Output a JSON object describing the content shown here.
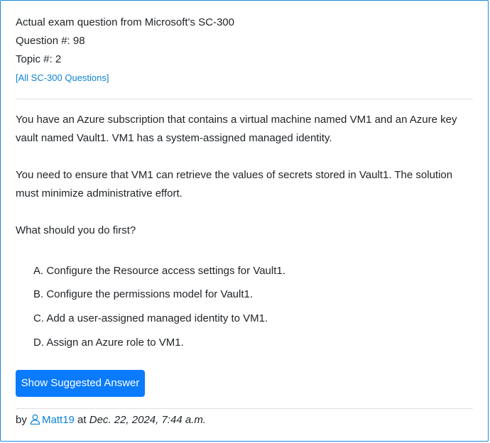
{
  "header": {
    "exam_line": "Actual exam question from Microsoft's SC-300",
    "question_number": "Question #: 98",
    "topic": "Topic #: 2",
    "all_questions_link": "[All SC-300 Questions]"
  },
  "question": {
    "paragraph_1": "You have an Azure subscription that contains a virtual machine named VM1 and an Azure key vault named Vault1. VM1 has a system-assigned managed identity.",
    "paragraph_2": "You need to ensure that VM1 can retrieve the values of secrets stored in Vault1. The solution must minimize administrative effort.",
    "prompt": "What should you do first?"
  },
  "choices": [
    "A. Configure the Resource access settings for Vault1.",
    "B. Configure the permissions model for Vault1.",
    "C. Add a user-assigned managed identity to VM1.",
    "D. Assign an Azure role to VM1."
  ],
  "actions": {
    "show_answer_label": "Show Suggested Answer"
  },
  "footer": {
    "by": "by",
    "username": "Matt19",
    "at": "at",
    "date": "Dec. 22, 2024, 7:44 a.m.",
    "user_icon": "user-icon"
  },
  "colors": {
    "border": "#1a8bd8",
    "link": "#0d83d6",
    "button": "#0a7bfc"
  }
}
